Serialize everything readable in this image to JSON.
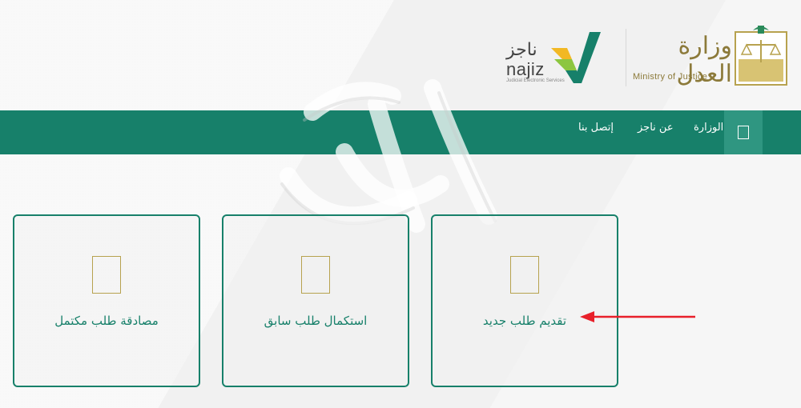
{
  "header": {
    "moj_logo": {
      "arabic": "وزارة العدل",
      "english": "Ministry of Justice"
    },
    "najiz_logo": {
      "arabic": "ناجز",
      "latin": "najiz",
      "sub": "Judicial Electronic Services"
    }
  },
  "nav": {
    "items": [
      "الوزارة",
      "عن ناجز",
      "إتصل بنا"
    ],
    "home_icon": "home-box-icon",
    "background": "#17806a"
  },
  "cards": [
    {
      "label": "تقديم طلب جديد",
      "icon": "document-icon"
    },
    {
      "label": "استكمال طلب سابق",
      "icon": "document-icon"
    },
    {
      "label": "مصادقة طلب مكتمل",
      "icon": "document-icon"
    }
  ],
  "colors": {
    "primary": "#17806a",
    "gold": "#b7a24f",
    "annotation": "#e8202a"
  }
}
